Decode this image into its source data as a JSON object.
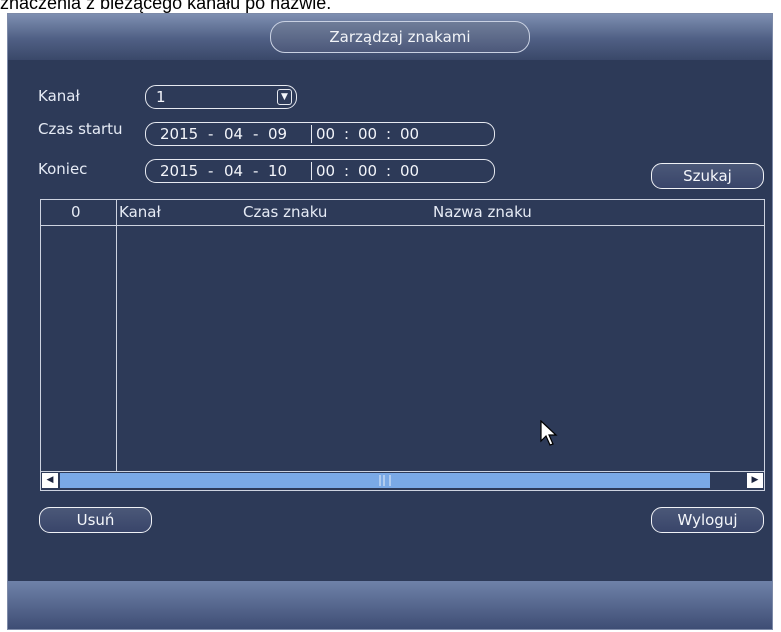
{
  "caption": "znaczenia z bieżącego kanału po nazwie.",
  "window": {
    "title": "Zarządzaj znakami"
  },
  "form": {
    "channel_label": "Kanał",
    "channel_value": "1",
    "start_label": "Czas startu",
    "start_date": {
      "year": "2015",
      "month": "04",
      "day": "09"
    },
    "start_time": {
      "h": "00",
      "m": "00",
      "s": "00"
    },
    "end_label": "Koniec",
    "end_date": {
      "year": "2015",
      "month": "04",
      "day": "10"
    },
    "end_time": {
      "h": "00",
      "m": "00",
      "s": "00"
    },
    "date_sep": "-",
    "time_sep": ":"
  },
  "buttons": {
    "search": "Szukaj",
    "delete": "Usuń",
    "logout": "Wyloguj"
  },
  "table": {
    "columns": [
      "0",
      "Kanał",
      "Czas znaku",
      "Nazwa znaku"
    ],
    "rows": []
  },
  "colors": {
    "window_bg": "#2d3a58",
    "titlebar": "#5a6b90",
    "scroll_thumb": "#7aa9e6"
  },
  "icons": {
    "dropdown": "chevron-down-icon",
    "scroll_left": "arrow-left-icon",
    "scroll_right": "arrow-right-icon",
    "cursor": "mouse-pointer-icon"
  }
}
